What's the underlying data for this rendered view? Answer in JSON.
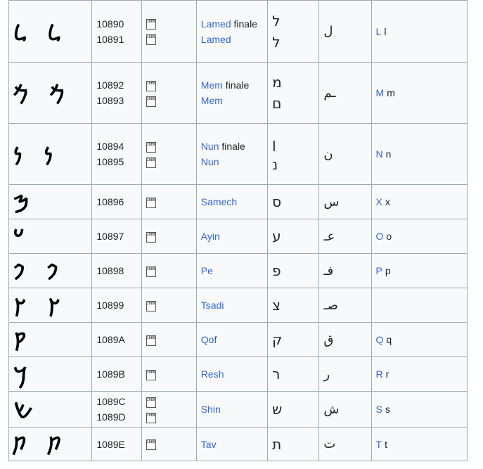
{
  "rows": [
    {
      "glyph": "𐡋 𐡋",
      "codes": [
        "10890",
        "10891"
      ],
      "names": [
        {
          "link": "Lamed",
          "suffix": " finale"
        },
        {
          "link": "Lamed",
          "suffix": ""
        }
      ],
      "hebrew": [
        "ל",
        "ל"
      ],
      "arabic": "ل",
      "latin_upper": "L",
      "latin_lower": "l"
    },
    {
      "glyph": "𐡌 𐡌",
      "codes": [
        "10892",
        "10893"
      ],
      "names": [
        {
          "link": "Mem",
          "suffix": " finale"
        },
        {
          "link": "Mem",
          "suffix": ""
        }
      ],
      "hebrew": [
        "מ",
        "ם"
      ],
      "arabic": "ـم",
      "latin_upper": "M",
      "latin_lower": "m"
    },
    {
      "glyph": "𐡍 𐡍",
      "codes": [
        "10894",
        "10895"
      ],
      "names": [
        {
          "link": "Nun",
          "suffix": " finale"
        },
        {
          "link": "Nun",
          "suffix": ""
        }
      ],
      "hebrew": [
        "ן",
        "נ"
      ],
      "arabic": "ن",
      "latin_upper": "N",
      "latin_lower": "n"
    },
    {
      "glyph": "𐡎",
      "codes": [
        "10896"
      ],
      "names": [
        {
          "link": "Samech",
          "suffix": ""
        }
      ],
      "hebrew": [
        "ס"
      ],
      "arabic": "س",
      "latin_upper": "X",
      "latin_lower": "x"
    },
    {
      "glyph": "𐡏",
      "codes": [
        "10897"
      ],
      "names": [
        {
          "link": "Ayin",
          "suffix": ""
        }
      ],
      "hebrew": [
        "ע"
      ],
      "arabic": "عـ",
      "latin_upper": "O",
      "latin_lower": "o"
    },
    {
      "glyph": "𐡐 𐡐",
      "codes": [
        "10898"
      ],
      "names": [
        {
          "link": "Pe",
          "suffix": ""
        }
      ],
      "hebrew": [
        "פ"
      ],
      "arabic": "فـ",
      "latin_upper": "P",
      "latin_lower": "p"
    },
    {
      "glyph": "𐡑 𐡑",
      "codes": [
        "10899"
      ],
      "names": [
        {
          "link": "Tsadi",
          "suffix": ""
        }
      ],
      "hebrew": [
        "צ"
      ],
      "arabic": "صـ",
      "latin_upper": "",
      "latin_lower": ""
    },
    {
      "glyph": "𐡒",
      "codes": [
        "1089A"
      ],
      "names": [
        {
          "link": "Qof",
          "suffix": ""
        }
      ],
      "hebrew": [
        "ק"
      ],
      "arabic": "ق",
      "latin_upper": "Q",
      "latin_lower": "q"
    },
    {
      "glyph": "𐡓",
      "codes": [
        "1089B"
      ],
      "names": [
        {
          "link": "Resh",
          "suffix": ""
        }
      ],
      "hebrew": [
        "ר"
      ],
      "arabic": "ر",
      "latin_upper": "R",
      "latin_lower": "r"
    },
    {
      "glyph": "𐡔",
      "codes": [
        "1089C",
        "1089D"
      ],
      "names": [
        {
          "link": "Shin",
          "suffix": ""
        }
      ],
      "hebrew": [
        "ש"
      ],
      "arabic": "ش",
      "latin_upper": "S",
      "latin_lower": "s"
    },
    {
      "glyph": "𐡕 𐡕",
      "codes": [
        "1089E"
      ],
      "names": [
        {
          "link": "Tav",
          "suffix": ""
        }
      ],
      "hebrew": [
        "ת"
      ],
      "arabic": "ت",
      "latin_upper": "T",
      "latin_lower": "t"
    }
  ],
  "colors": {
    "link": "#3366cc",
    "border": "#a2a9b1",
    "cell_bg": "#f8f9fa"
  },
  "icons": {
    "codepoint_box": "unicode-codepoint-box-icon"
  }
}
